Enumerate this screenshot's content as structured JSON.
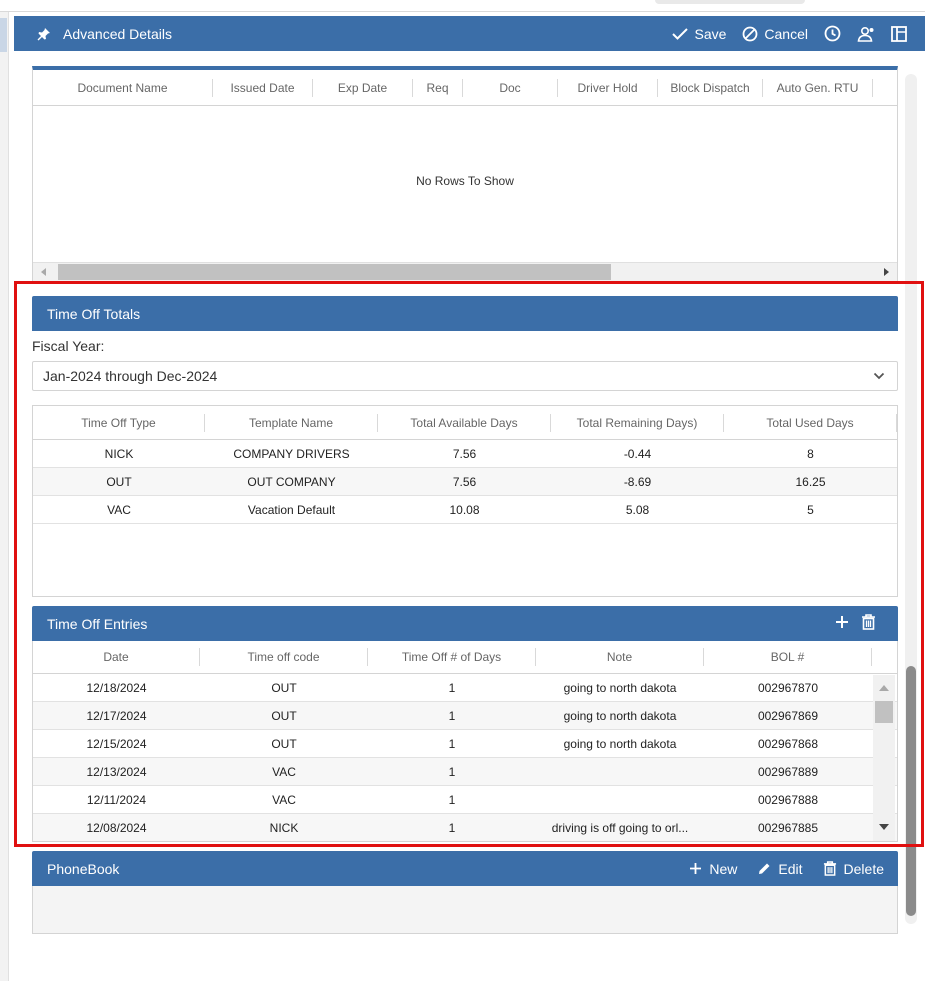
{
  "header": {
    "title": "Advanced Details",
    "save_label": "Save",
    "cancel_label": "Cancel"
  },
  "documents": {
    "columns": [
      "Document Name",
      "Issued Date",
      "Exp Date",
      "Req",
      "Doc",
      "Driver Hold",
      "Block Dispatch",
      "Auto Gen. RTU"
    ],
    "empty_text": "No Rows To Show"
  },
  "time_off_totals": {
    "title": "Time Off Totals",
    "fiscal_label": "Fiscal Year:",
    "fiscal_value": "Jan-2024 through Dec-2024",
    "columns": [
      "Time Off Type",
      "Template Name",
      "Total Available Days",
      "Total Remaining Days)",
      "Total Used Days"
    ],
    "rows": [
      [
        "NICK",
        "COMPANY DRIVERS",
        "7.56",
        "-0.44",
        "8"
      ],
      [
        "OUT",
        "OUT COMPANY",
        "7.56",
        "-8.69",
        "16.25"
      ],
      [
        "VAC",
        "Vacation Default",
        "10.08",
        "5.08",
        "5"
      ]
    ]
  },
  "time_off_entries": {
    "title": "Time Off Entries",
    "columns": [
      "Date",
      "Time off code",
      "Time Off # of Days",
      "Note",
      "BOL #"
    ],
    "rows": [
      [
        "12/18/2024",
        "OUT",
        "1",
        "going to north dakota",
        "002967870"
      ],
      [
        "12/17/2024",
        "OUT",
        "1",
        "going to north dakota",
        "002967869"
      ],
      [
        "12/15/2024",
        "OUT",
        "1",
        "going to north dakota",
        "002967868"
      ],
      [
        "12/13/2024",
        "VAC",
        "1",
        "",
        "002967889"
      ],
      [
        "12/11/2024",
        "VAC",
        "1",
        "",
        "002967888"
      ],
      [
        "12/08/2024",
        "NICK",
        "1",
        "driving is off going to orl...",
        "002967885"
      ]
    ]
  },
  "phonebook": {
    "title": "PhoneBook",
    "new_label": "New",
    "edit_label": "Edit",
    "delete_label": "Delete"
  },
  "colors": {
    "header_blue": "#3b6ea8",
    "highlight_red": "#e01010"
  }
}
